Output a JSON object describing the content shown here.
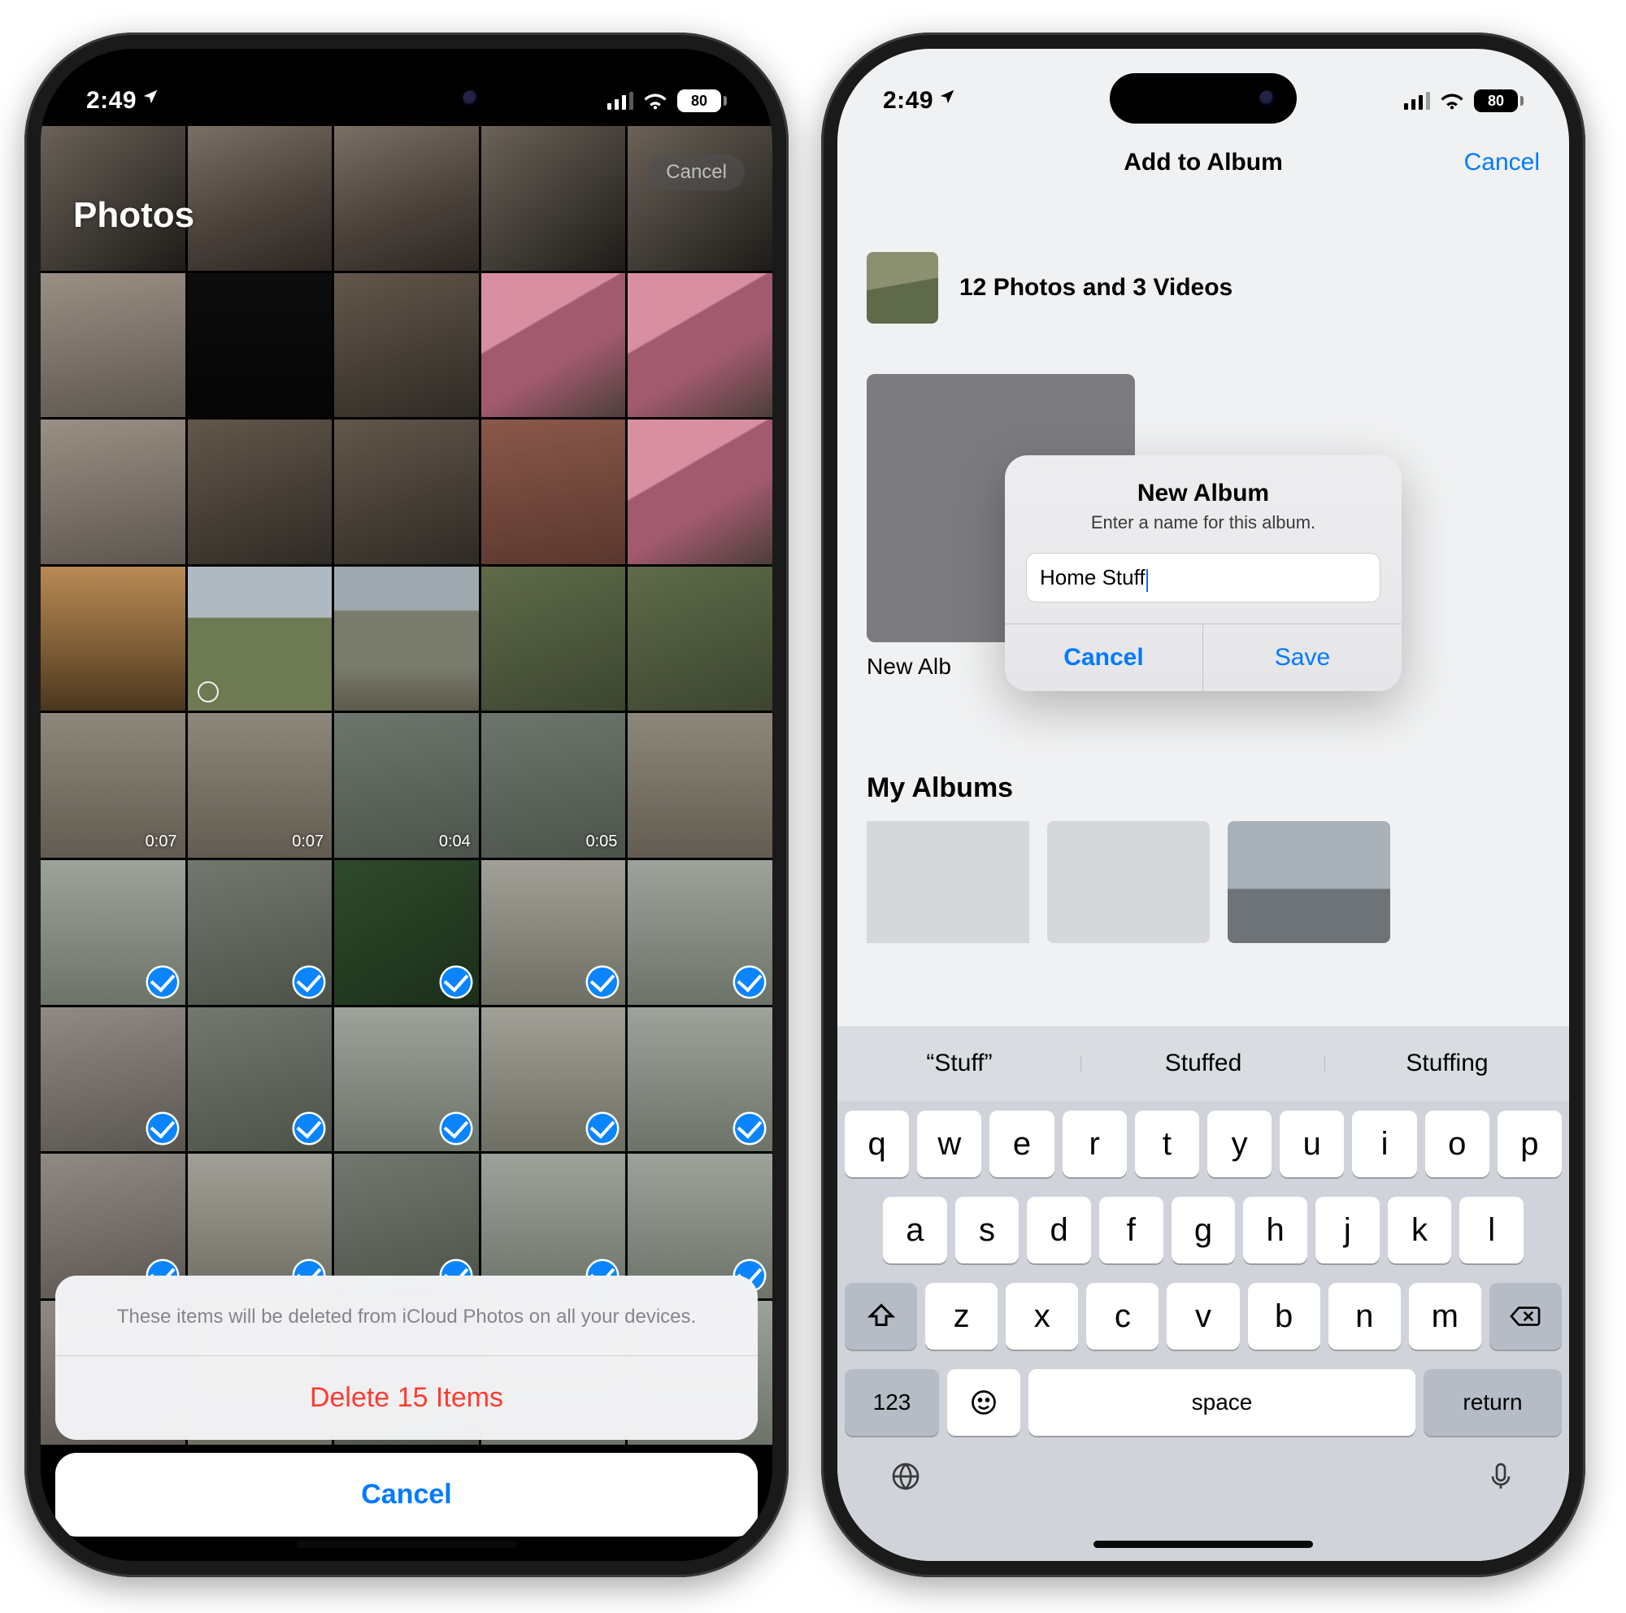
{
  "status": {
    "time": "2:49",
    "battery": "80"
  },
  "left": {
    "app_title": "Photos",
    "top_cancel": "Cancel",
    "video_durations": [
      "0:07",
      "0:07",
      "0:04",
      "0:05"
    ],
    "sheet_message": "These items will be deleted from iCloud Photos on all your devices.",
    "delete_label": "Delete 15 Items",
    "cancel_label": "Cancel"
  },
  "right": {
    "nav_title": "Add to Album",
    "nav_cancel": "Cancel",
    "selection_count": "12 Photos and 3 Videos",
    "new_album_tile_label": "New Alb",
    "my_albums_header": "My Albums",
    "dialog": {
      "title": "New Album",
      "subtitle": "Enter a name for this album.",
      "input_value": "Home Stuff",
      "cancel": "Cancel",
      "save": "Save"
    },
    "keyboard": {
      "predictions": [
        "“Stuff”",
        "Stuffed",
        "Stuffing"
      ],
      "row1": [
        "q",
        "w",
        "e",
        "r",
        "t",
        "y",
        "u",
        "i",
        "o",
        "p"
      ],
      "row2": [
        "a",
        "s",
        "d",
        "f",
        "g",
        "h",
        "j",
        "k",
        "l"
      ],
      "row3": [
        "z",
        "x",
        "c",
        "v",
        "b",
        "n",
        "m"
      ],
      "num_key": "123",
      "space": "space",
      "return": "return"
    }
  }
}
